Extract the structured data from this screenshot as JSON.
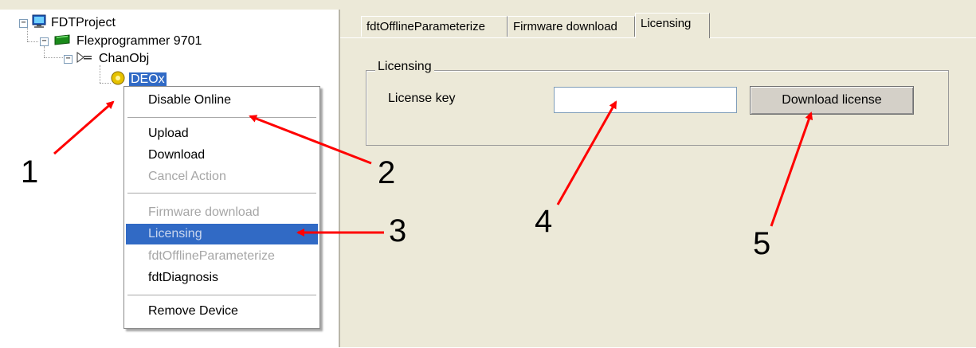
{
  "tree": {
    "root": "FDTProject",
    "device": "Flexprogrammer 9701",
    "channel": "ChanObj",
    "selected_node": "DEOx",
    "icons": [
      "computer-icon",
      "flexprogrammer-device-icon",
      "channel-connector-icon",
      "dtm-device-icon"
    ],
    "expander_symbol": "−"
  },
  "context_menu": {
    "items": [
      {
        "label": "Disable Online",
        "enabled": true
      },
      {
        "label": "Upload",
        "enabled": true
      },
      {
        "label": "Download",
        "enabled": true
      },
      {
        "label": "Cancel Action",
        "enabled": false
      },
      {
        "label": "Firmware download",
        "enabled": false
      },
      {
        "label": "Licensing",
        "enabled": false,
        "highlighted": true
      },
      {
        "label": "fdtOfflineParameterize",
        "enabled": false
      },
      {
        "label": "fdtDiagnosis",
        "enabled": true
      },
      {
        "label": "Remove Device",
        "enabled": true
      }
    ]
  },
  "tabs": [
    {
      "label": "fdtOfflineParameterize",
      "active": false
    },
    {
      "label": "Firmware download",
      "active": false
    },
    {
      "label": "Licensing",
      "active": true
    }
  ],
  "licensing": {
    "group_title": "Licensing",
    "license_key_label": "License key",
    "license_key_value": "",
    "download_button": "Download license"
  },
  "annotations": [
    "1",
    "2",
    "3",
    "4",
    "5"
  ],
  "colors": {
    "selection": "#316ac5",
    "arrow": "#ff0000",
    "panel_bg": "#ece9d8"
  }
}
